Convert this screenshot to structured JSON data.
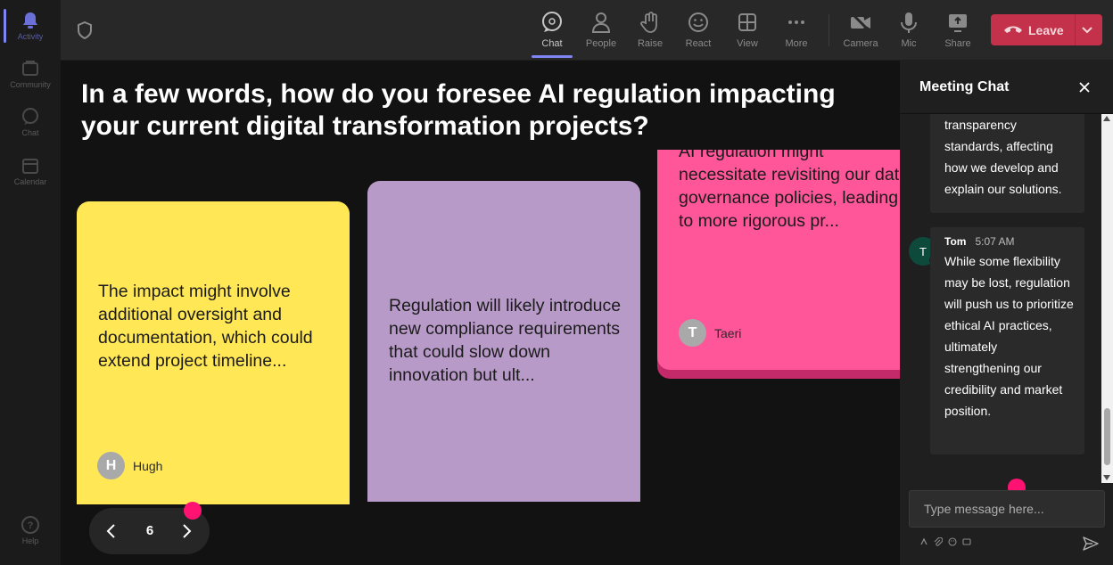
{
  "rail": {
    "items": [
      {
        "label": "Activity",
        "icon": "bell-icon"
      },
      {
        "label": "Community",
        "icon": "community-icon"
      },
      {
        "label": "Chat",
        "icon": "chat-icon"
      },
      {
        "label": "Calendar",
        "icon": "calendar-icon"
      },
      {
        "label": "Help",
        "icon": "help-icon"
      }
    ]
  },
  "toolbar": {
    "chat": "Chat",
    "people": "People",
    "raise": "Raise",
    "react": "React",
    "view": "View",
    "more": "More",
    "camera": "Camera",
    "mic": "Mic",
    "share": "Share",
    "leave": "Leave"
  },
  "stage": {
    "question": "In a few words, how do you foresee AI regulation impacting your current digital transformation projects?",
    "cards": [
      {
        "text": "The impact might involve additional oversight and documentation, which could extend project timeline...",
        "author": "Hugh",
        "initial": "H",
        "color": "#ffe756"
      },
      {
        "text": "Regulation will likely introduce new compliance requirements that could slow down innovation but ult...",
        "author": "",
        "initial": "",
        "color": "#b89ac8"
      },
      {
        "text": "AI regulation might necessitate revisiting our data governance policies, leading to more rigorous pr...",
        "author": "Taeri",
        "initial": "T",
        "color": "#ff5599"
      }
    ],
    "pager": {
      "page": "6"
    }
  },
  "chat": {
    "title": "Meeting Chat",
    "messages": [
      {
        "text": "transparency standards, affecting how we develop and explain our solutions."
      },
      {
        "author": "Tom",
        "initial": "T",
        "time": "5:07 AM",
        "text": "While some flexibility may be lost, regulation will push us to prioritize ethical AI practices, ultimately strengthening our credibility and market position."
      }
    ],
    "input_placeholder": "Type message here..."
  },
  "colors": {
    "accent": "#7f85f5",
    "leave": "#c4314b",
    "dot": "#ff1271"
  }
}
